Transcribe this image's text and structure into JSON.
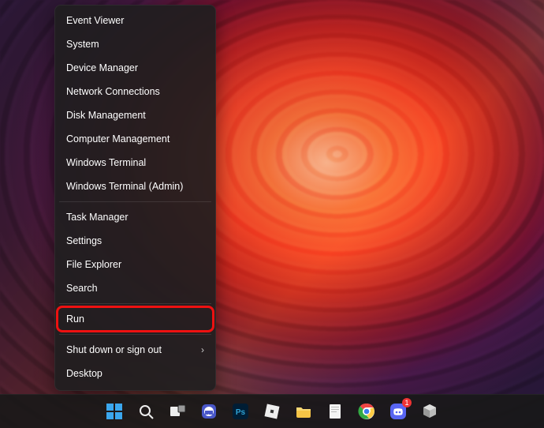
{
  "menu": {
    "sections": [
      [
        {
          "label": "Event Viewer",
          "name": "menu-event-viewer"
        },
        {
          "label": "System",
          "name": "menu-system"
        },
        {
          "label": "Device Manager",
          "name": "menu-device-manager"
        },
        {
          "label": "Network Connections",
          "name": "menu-network-connections"
        },
        {
          "label": "Disk Management",
          "name": "menu-disk-management"
        },
        {
          "label": "Computer Management",
          "name": "menu-computer-management"
        },
        {
          "label": "Windows Terminal",
          "name": "menu-windows-terminal"
        },
        {
          "label": "Windows Terminal (Admin)",
          "name": "menu-windows-terminal-admin"
        }
      ],
      [
        {
          "label": "Task Manager",
          "name": "menu-task-manager"
        },
        {
          "label": "Settings",
          "name": "menu-settings"
        },
        {
          "label": "File Explorer",
          "name": "menu-file-explorer"
        },
        {
          "label": "Search",
          "name": "menu-search"
        }
      ],
      [
        {
          "label": "Run",
          "name": "menu-run",
          "highlight": true
        }
      ],
      [
        {
          "label": "Shut down or sign out",
          "name": "menu-shut-down",
          "submenu": true
        },
        {
          "label": "Desktop",
          "name": "menu-desktop"
        }
      ]
    ]
  },
  "taskbar": {
    "items": [
      {
        "name": "start-button",
        "icon": "windows"
      },
      {
        "name": "search-button",
        "icon": "search"
      },
      {
        "name": "task-view-button",
        "icon": "taskview"
      },
      {
        "name": "chat-button",
        "icon": "chat"
      },
      {
        "name": "photoshop-button",
        "icon": "ps"
      },
      {
        "name": "roblox-button",
        "icon": "roblox"
      },
      {
        "name": "file-explorer-button",
        "icon": "folder"
      },
      {
        "name": "notes-button",
        "icon": "note"
      },
      {
        "name": "chrome-button",
        "icon": "chrome"
      },
      {
        "name": "discord-button",
        "icon": "discord",
        "badge": "1"
      },
      {
        "name": "app-button",
        "icon": "cube"
      }
    ]
  }
}
